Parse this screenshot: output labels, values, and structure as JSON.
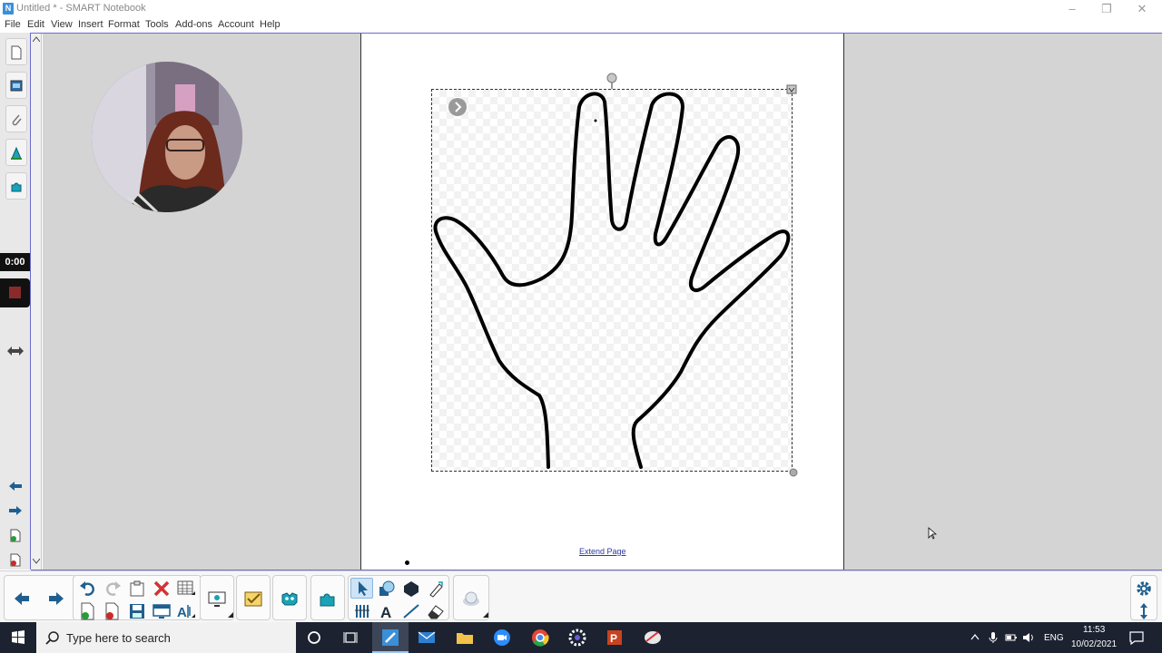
{
  "window": {
    "title": "Untitled * - SMART Notebook",
    "minimize": "–",
    "restore": "❐",
    "close": "✕"
  },
  "menu": [
    "File",
    "Edit",
    "View",
    "Insert",
    "Format",
    "Tools",
    "Add-ons",
    "Account",
    "Help"
  ],
  "recorder": {
    "timer": "0:00"
  },
  "page": {
    "extend_label": "Extend Page"
  },
  "taskbar": {
    "search_placeholder": "Type here to search",
    "language": "ENG",
    "time": "11:53",
    "date": "10/02/2021"
  },
  "colors": {
    "accent_border": "#6b6bd0",
    "toolbar_icon_teal": "#1aa3b8",
    "select_active": "#cde3f7",
    "delete_red": "#d33333",
    "taskbar_bg": "#1c2230"
  }
}
